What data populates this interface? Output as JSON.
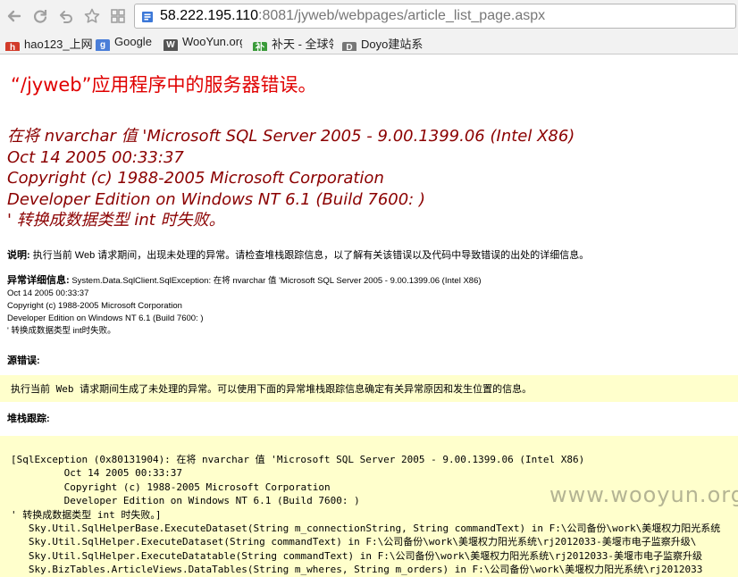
{
  "browser": {
    "address": {
      "host": "58.222.195.110",
      "path": ":8081/jyweb/webpages/article_list_page.aspx"
    },
    "bookmarks": [
      {
        "label": "hao123_上网",
        "icon": "hao123-icon",
        "color": "#d23b2a"
      },
      {
        "label": "Google",
        "icon": "google-icon",
        "color": "#4a7ed8"
      },
      {
        "label": "WooYun.org",
        "icon": "wooyun-icon",
        "color": "#555555"
      },
      {
        "label": "补天 - 全球领",
        "icon": "butian-icon",
        "color": "#3a9b3a"
      },
      {
        "label": "Doyo建站系",
        "icon": "doyo-icon",
        "color": "#777777"
      }
    ]
  },
  "page": {
    "title": "“/jyweb”应用程序中的服务器错误。",
    "error_lines": [
      "在将 nvarchar 值 'Microsoft SQL Server 2005 - 9.00.1399.06 (Intel X86)",
      "Oct 14 2005 00:33:37",
      "Copyright (c) 1988-2005 Microsoft Corporation",
      "Developer Edition on Windows NT 6.1 (Build 7600: )",
      "' 转换成数据类型 int 时失败。"
    ],
    "description_label": "说明:",
    "description_text": "执行当前 Web 请求期间，出现未处理的异常。请检查堆栈跟踪信息，以了解有关该错误以及代码中导致错误的出处的详细信息。",
    "exception_label": "异常详细信息:",
    "exception_lines": [
      "System.Data.SqlClient.SqlException: 在将  nvarchar 值  'Microsoft SQL Server 2005 - 9.00.1399.06 (Intel X86)",
      "Oct 14 2005 00:33:37",
      "Copyright (c) 1988-2005 Microsoft Corporation",
      "Developer Edition on Windows NT 6.1 (Build 7600: )",
      "' 转换成数据类型  int时失败。"
    ],
    "source_error_heading": "源错误:",
    "source_error_text": "执行当前 Web 请求期间生成了未处理的异常。可以使用下面的异常堆栈跟踪信息确定有关异常原因和发生位置的信息。",
    "stack_heading": "堆栈跟踪:",
    "stack_lines": [
      "[SqlException (0x80131904): 在将 nvarchar 值 'Microsoft SQL Server 2005 - 9.00.1399.06 (Intel X86)",
      "         Oct 14 2005 00:33:37",
      "         Copyright (c) 1988-2005 Microsoft Corporation",
      "         Developer Edition on Windows NT 6.1 (Build 7600: )",
      "' 转换成数据类型 int 时失败。]",
      "   Sky.Util.SqlHelperBase.ExecuteDataset(String m_connectionString, String commandText) in F:\\公司备份\\work\\美堰权力阳光系统",
      "   Sky.Util.SqlHelper.ExecuteDataset(String commandText) in F:\\公司备份\\work\\美堰权力阳光系统\\rj2012033-美堰市电子监察升级\\",
      "   Sky.Util.SqlHelper.ExecuteDatatable(String commandText) in F:\\公司备份\\work\\美堰权力阳光系统\\rj2012033-美堰市电子监察升级",
      "   Sky.BizTables.ArticleViews.DataTables(String m_wheres, String m_orders) in F:\\公司备份\\work\\美堰权力阳光系统\\rj2012033"
    ],
    "watermark": "www.wooyun.org"
  }
}
